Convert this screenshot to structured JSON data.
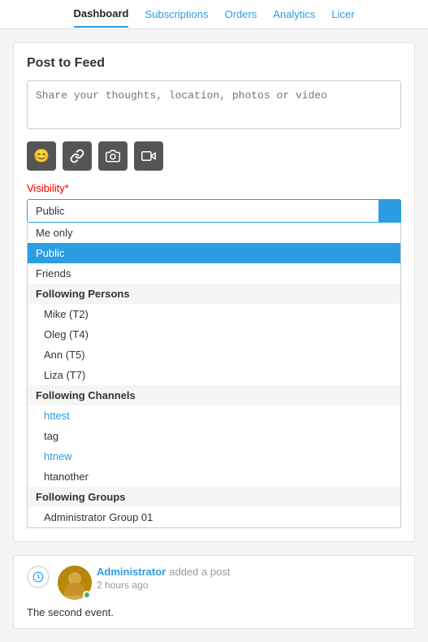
{
  "nav": {
    "items": [
      {
        "label": "Dashboard",
        "active": true
      },
      {
        "label": "Subscriptions",
        "active": false
      },
      {
        "label": "Orders",
        "active": false
      },
      {
        "label": "Analytics",
        "active": false
      },
      {
        "label": "Licer",
        "active": false
      }
    ]
  },
  "post_feed": {
    "title": "Post to Feed",
    "textarea_placeholder": "Share your thoughts, location, photos or video",
    "icons": [
      {
        "name": "emoji-icon",
        "symbol": "😊"
      },
      {
        "name": "link-icon",
        "symbol": "🔗"
      },
      {
        "name": "camera-icon",
        "symbol": "📷"
      },
      {
        "name": "video-icon",
        "symbol": "🎬"
      }
    ],
    "visibility_label": "Visibility",
    "required_mark": "*",
    "selected_value": "Public"
  },
  "dropdown": {
    "items": [
      {
        "type": "item",
        "label": "Me only",
        "selected": false
      },
      {
        "type": "item",
        "label": "Public",
        "selected": true
      },
      {
        "type": "item",
        "label": "Friends",
        "selected": false
      },
      {
        "type": "group",
        "label": "Following Persons"
      },
      {
        "type": "child",
        "label": "Mike (T2)",
        "link": false
      },
      {
        "type": "child",
        "label": "Oleg (T4)",
        "link": false
      },
      {
        "type": "child",
        "label": "Ann (T5)",
        "link": false
      },
      {
        "type": "child",
        "label": "Liza (T7)",
        "link": false
      },
      {
        "type": "group",
        "label": "Following Channels"
      },
      {
        "type": "child",
        "label": "httest",
        "link": true
      },
      {
        "type": "child",
        "label": "tag",
        "link": false
      },
      {
        "type": "child",
        "label": "htnew",
        "link": true
      },
      {
        "type": "child",
        "label": "htanother",
        "link": false
      },
      {
        "type": "group",
        "label": "Following Groups"
      },
      {
        "type": "child",
        "label": "Administrator Group 01",
        "link": false
      }
    ]
  },
  "feed": {
    "author": "Administrator",
    "action": "added a post",
    "time": "2 hours ago",
    "text": "The second event."
  }
}
